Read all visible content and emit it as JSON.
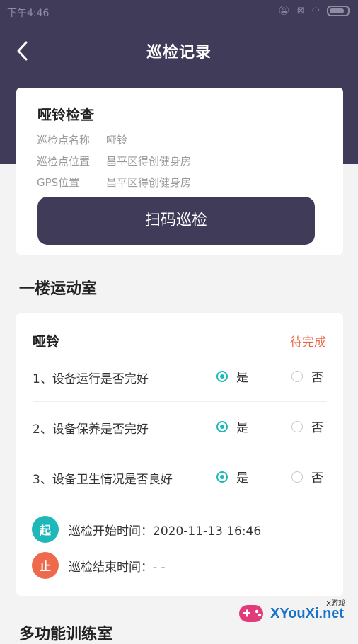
{
  "status_bar": {
    "time": "下午4:46"
  },
  "nav": {
    "title": "巡检记录"
  },
  "point_card": {
    "title": "哑铃检查",
    "rows": [
      {
        "label": "巡检点名称",
        "value": "哑铃"
      },
      {
        "label": "巡检点位置",
        "value": "昌平区得创健身房"
      },
      {
        "label": "GPS位置",
        "value": "昌平区得创健身房"
      }
    ],
    "scan_button": "扫码巡检"
  },
  "section1": {
    "title": "一楼运动室"
  },
  "item_card": {
    "name": "哑铃",
    "status": "待完成",
    "questions": [
      {
        "text": "1、设备运行是否完好",
        "yes": "是",
        "no": "否",
        "selected": "yes"
      },
      {
        "text": "2、设备保养是否完好",
        "yes": "是",
        "no": "否",
        "selected": "yes"
      },
      {
        "text": "3、设备卫生情况是否良好",
        "yes": "是",
        "no": "否",
        "selected": "yes"
      }
    ],
    "start": {
      "badge": "起",
      "text": "巡检开始时间：2020-11-13 16:46"
    },
    "end": {
      "badge": "止",
      "text": "巡检结束时间：- -"
    }
  },
  "section2": {
    "title": "多功能训练室"
  },
  "watermark": {
    "text": "XYouXi.net",
    "small": "X游戏"
  },
  "colors": {
    "header": "#3f3b59",
    "accent": "#1fb8b8",
    "status_pending": "#e9664b",
    "badge_start": "#1fb8b8",
    "badge_end": "#ef6a4c"
  }
}
